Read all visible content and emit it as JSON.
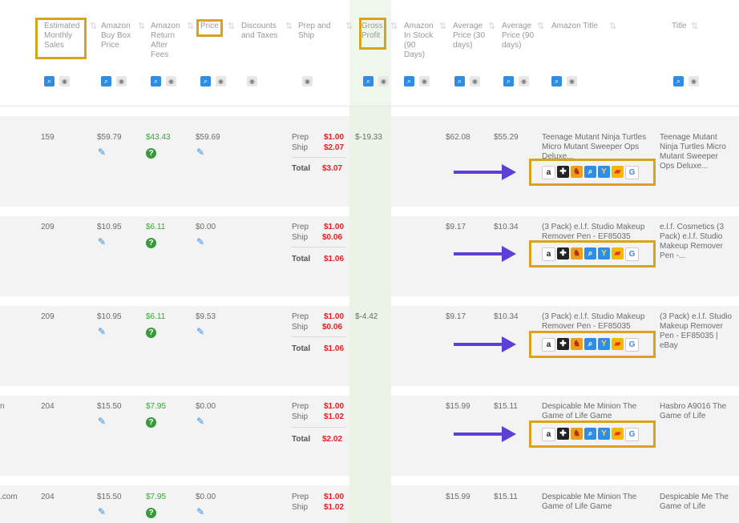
{
  "headers": {
    "est_monthly_sales": "Estimated Monthly Sales",
    "buy_box": "Amazon Buy Box Price",
    "return_after_fees": "Amazon Return After Fees",
    "price": "Price",
    "discounts": "Discounts and Taxes",
    "prep_ship": "Prep and Ship",
    "gross_profit": "Gross Profit",
    "in_stock": "Amazon In Stock (90 Days)",
    "avg30": "Average Price (30 days)",
    "avg90": "Average Price (90 days)",
    "amazon_title": "Amazon Title",
    "title": "Title"
  },
  "labels": {
    "prep": "Prep",
    "ship": "Ship",
    "total": "Total"
  },
  "rows": [
    {
      "sales": "159",
      "buybox": "$59.79",
      "return": "$43.43",
      "price": "$59.69",
      "prep": "$1.00",
      "ship": "$2.07",
      "total": "$3.07",
      "gross": "$-19.33",
      "avg30": "$62.08",
      "avg90": "$55.29",
      "amazon_title": "Teenage Mutant Ninja Turtles Micro Mutant Sweeper Ops Deluxe...",
      "title": "Teenage Mutant Ninja Turtles Micro Mutant Sweeper Ops Deluxe...",
      "left_text": ""
    },
    {
      "sales": "209",
      "buybox": "$10.95",
      "return": "$6.11",
      "price": "$0.00",
      "prep": "$1.00",
      "ship": "$0.06",
      "total": "$1.06",
      "gross": "",
      "avg30": "$9.17",
      "avg90": "$10.34",
      "amazon_title": "(3 Pack) e.l.f. Studio Makeup Remover Pen - EF85035",
      "title": "e.l.f. Cosmetics (3 Pack) e.l.f. Studio Makeup Remover Pen -...",
      "left_text": ""
    },
    {
      "sales": "209",
      "buybox": "$10.95",
      "return": "$6.11",
      "price": "$9.53",
      "prep": "$1.00",
      "ship": "$0.06",
      "total": "$1.06",
      "gross": "$-4.42",
      "avg30": "$9.17",
      "avg90": "$10.34",
      "amazon_title": "(3 Pack) e.l.f. Studio Makeup Remover Pen - EF85035",
      "title": "(3 Pack) e.l.f. Studio Makeup Remover Pen - EF85035 | eBay",
      "left_text": ""
    },
    {
      "sales": "204",
      "buybox": "$15.50",
      "return": "$7.95",
      "price": "$0.00",
      "prep": "$1.00",
      "ship": "$1.02",
      "total": "$2.02",
      "gross": "",
      "avg30": "$15.99",
      "avg90": "$15.11",
      "amazon_title": "Despicable Me Minion The Game of Life Game",
      "title": "Hasbro A9016 The Game of Life",
      "left_text": "n"
    },
    {
      "sales": "204",
      "buybox": "$15.50",
      "return": "$7.95",
      "price": "$0.00",
      "prep": "$1.00",
      "ship": "$1.02",
      "total": "",
      "gross": "",
      "avg30": "$15.99",
      "avg90": "$15.11",
      "amazon_title": "Despicable Me Minion The Game of Life Game",
      "title": "Despicable Me The Game of Life",
      "left_text": ".com"
    }
  ],
  "lookup_icons": [
    "amazon-icon",
    "keepa-icon",
    "camel-icon",
    "search-icon",
    "walmart-icon",
    "ebay-icon",
    "google-icon"
  ],
  "colors": {
    "highlight": "#d9a41c",
    "arrow": "#5b3fd6",
    "link_blue": "#2f8de4",
    "profit_green": "#3aa63a",
    "cost_red": "#e02020"
  }
}
